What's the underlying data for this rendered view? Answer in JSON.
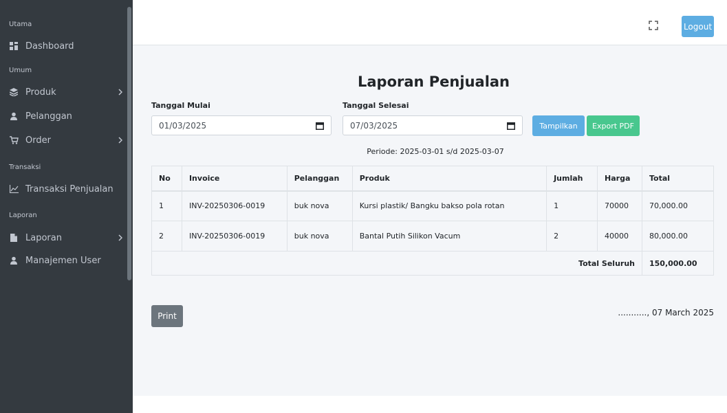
{
  "sidebar": {
    "sections": {
      "utama": "Utama",
      "umum": "Umum",
      "transaksi": "Transaksi",
      "laporan": "Laporan"
    },
    "items": {
      "dashboard": "Dashboard",
      "produk": "Produk",
      "pelanggan": "Pelanggan",
      "order": "Order",
      "transaksi_penjualan": "Transaksi Penjualan",
      "laporan": "Laporan",
      "manajemen_user": "Manajemen User"
    }
  },
  "topbar": {
    "logout_label": "Logout"
  },
  "report": {
    "title": "Laporan Penjualan",
    "start_label": "Tanggal Mulai",
    "start_value": "01/03/2025",
    "end_label": "Tanggal Selesai",
    "end_value": "07/03/2025",
    "show_button": "Tampilkan",
    "pdf_button": "Export PDF",
    "periode": "Periode: 2025-03-01 s/d 2025-03-07",
    "columns": [
      "No",
      "Invoice",
      "Pelanggan",
      "Produk",
      "Jumlah",
      "Harga",
      "Total"
    ],
    "rows": [
      [
        "1",
        "INV-20250306-0019",
        "buk nova",
        "Kursi plastik/ Bangku bakso pola rotan",
        "1",
        "70000",
        "70,000.00"
      ],
      [
        "2",
        "INV-20250306-0019",
        "buk nova",
        "Bantal Putih Silikon Vacum",
        "2",
        "40000",
        "80,000.00"
      ]
    ],
    "total_label": "Total Seluruh",
    "total_value": "150,000.00",
    "print_button": "Print",
    "signature_date": "..........., 07 March 2025"
  },
  "colors": {
    "sidebar_bg": "#343a40",
    "info": "#5dade2",
    "success": "#48c78e",
    "secondary": "#6c757d",
    "content_bg": "#f4f6f9"
  }
}
